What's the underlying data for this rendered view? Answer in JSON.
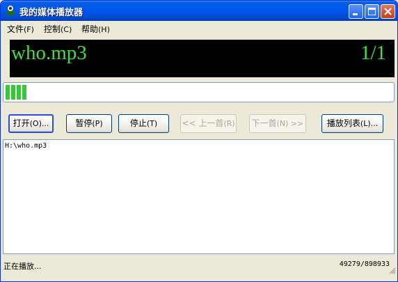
{
  "window": {
    "title": "我的媒体播放器"
  },
  "menu": [
    {
      "label": "文件",
      "accel": "(F)"
    },
    {
      "label": "控制",
      "accel": "(C)"
    },
    {
      "label": "帮助",
      "accel": "(H)"
    }
  ],
  "display": {
    "song": "who.mp3",
    "track_counter": "1/1",
    "text_color": "#3ee23e"
  },
  "progress": {
    "fraction": 0.055,
    "color": "#35c935"
  },
  "buttons": {
    "open": {
      "label": "打开",
      "accel": "(O)..."
    },
    "pause": {
      "label": "暂停",
      "accel": "(P)"
    },
    "stop": {
      "label": "停止",
      "accel": "(T)"
    },
    "prev": {
      "label": "<< 上一首",
      "accel": "(R)"
    },
    "next": {
      "label": "下一首",
      "accel": "(N) >>"
    },
    "playlist": {
      "label": "播放列表",
      "accel": "(L)..."
    }
  },
  "playlist": {
    "items": [
      "H:\\who.mp3"
    ]
  },
  "status": {
    "text": "正在播放...",
    "position": "49279/898933"
  }
}
